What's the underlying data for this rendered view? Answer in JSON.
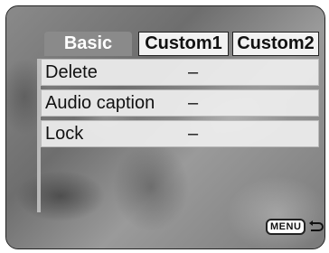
{
  "tabs": [
    {
      "label": "Basic",
      "active": true
    },
    {
      "label": "Custom1",
      "active": false
    },
    {
      "label": "Custom2",
      "active": false
    }
  ],
  "menu_items": [
    {
      "label": "Delete",
      "value": "–"
    },
    {
      "label": "Audio caption",
      "value": "–"
    },
    {
      "label": "Lock",
      "value": "–"
    }
  ],
  "footer": {
    "menu_button_label": "MENU",
    "return_icon": "return-arrow-icon"
  },
  "colors": {
    "active_tab_bg": "#8a8a8a",
    "active_tab_text": "#ffffff",
    "inactive_tab_bg": "#f2f2f2",
    "row_bg": "#eeeeee"
  }
}
